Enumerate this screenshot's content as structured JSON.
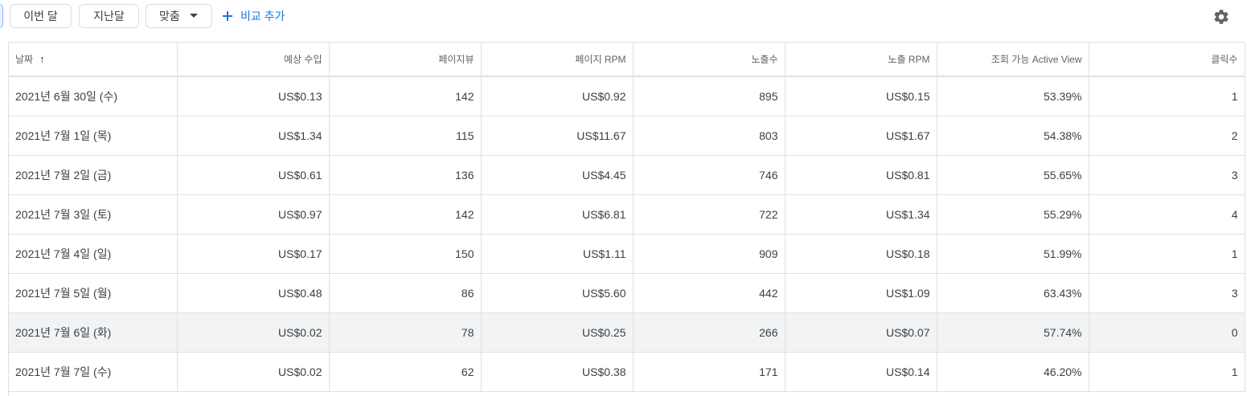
{
  "toolbar": {
    "chips": [
      "이번 달",
      "지난달"
    ],
    "custom_label": "맞춤",
    "add_compare_label": "비교 추가"
  },
  "icons": {
    "caret": "chevron-down-icon",
    "plus": "plus-icon",
    "settings": "gear-icon"
  },
  "colors": {
    "accent": "#1a73e8",
    "border": "#e0e0e0",
    "highlight_row": "#f1f3f4"
  },
  "table": {
    "headers": [
      "날짜",
      "예상 수입",
      "페이지뷰",
      "페이지 RPM",
      "노출수",
      "노출 RPM",
      "조회 가능 Active View",
      "클릭수"
    ],
    "rows": [
      [
        "2021년 6월 30일 (수)",
        "US$0.13",
        "142",
        "US$0.92",
        "895",
        "US$0.15",
        "53.39%",
        "1"
      ],
      [
        "2021년 7월 1일 (목)",
        "US$1.34",
        "115",
        "US$11.67",
        "803",
        "US$1.67",
        "54.38%",
        "2"
      ],
      [
        "2021년 7월 2일 (금)",
        "US$0.61",
        "136",
        "US$4.45",
        "746",
        "US$0.81",
        "55.65%",
        "3"
      ],
      [
        "2021년 7월 3일 (토)",
        "US$0.97",
        "142",
        "US$6.81",
        "722",
        "US$1.34",
        "55.29%",
        "4"
      ],
      [
        "2021년 7월 4일 (일)",
        "US$0.17",
        "150",
        "US$1.11",
        "909",
        "US$0.18",
        "51.99%",
        "1"
      ],
      [
        "2021년 7월 5일 (월)",
        "US$0.48",
        "86",
        "US$5.60",
        "442",
        "US$1.09",
        "63.43%",
        "3"
      ],
      [
        "2021년 7월 6일 (화)",
        "US$0.02",
        "78",
        "US$0.25",
        "266",
        "US$0.07",
        "57.74%",
        "0"
      ],
      [
        "2021년 7월 7일 (수)",
        "US$0.02",
        "62",
        "US$0.38",
        "171",
        "US$0.14",
        "46.20%",
        "1"
      ]
    ]
  }
}
